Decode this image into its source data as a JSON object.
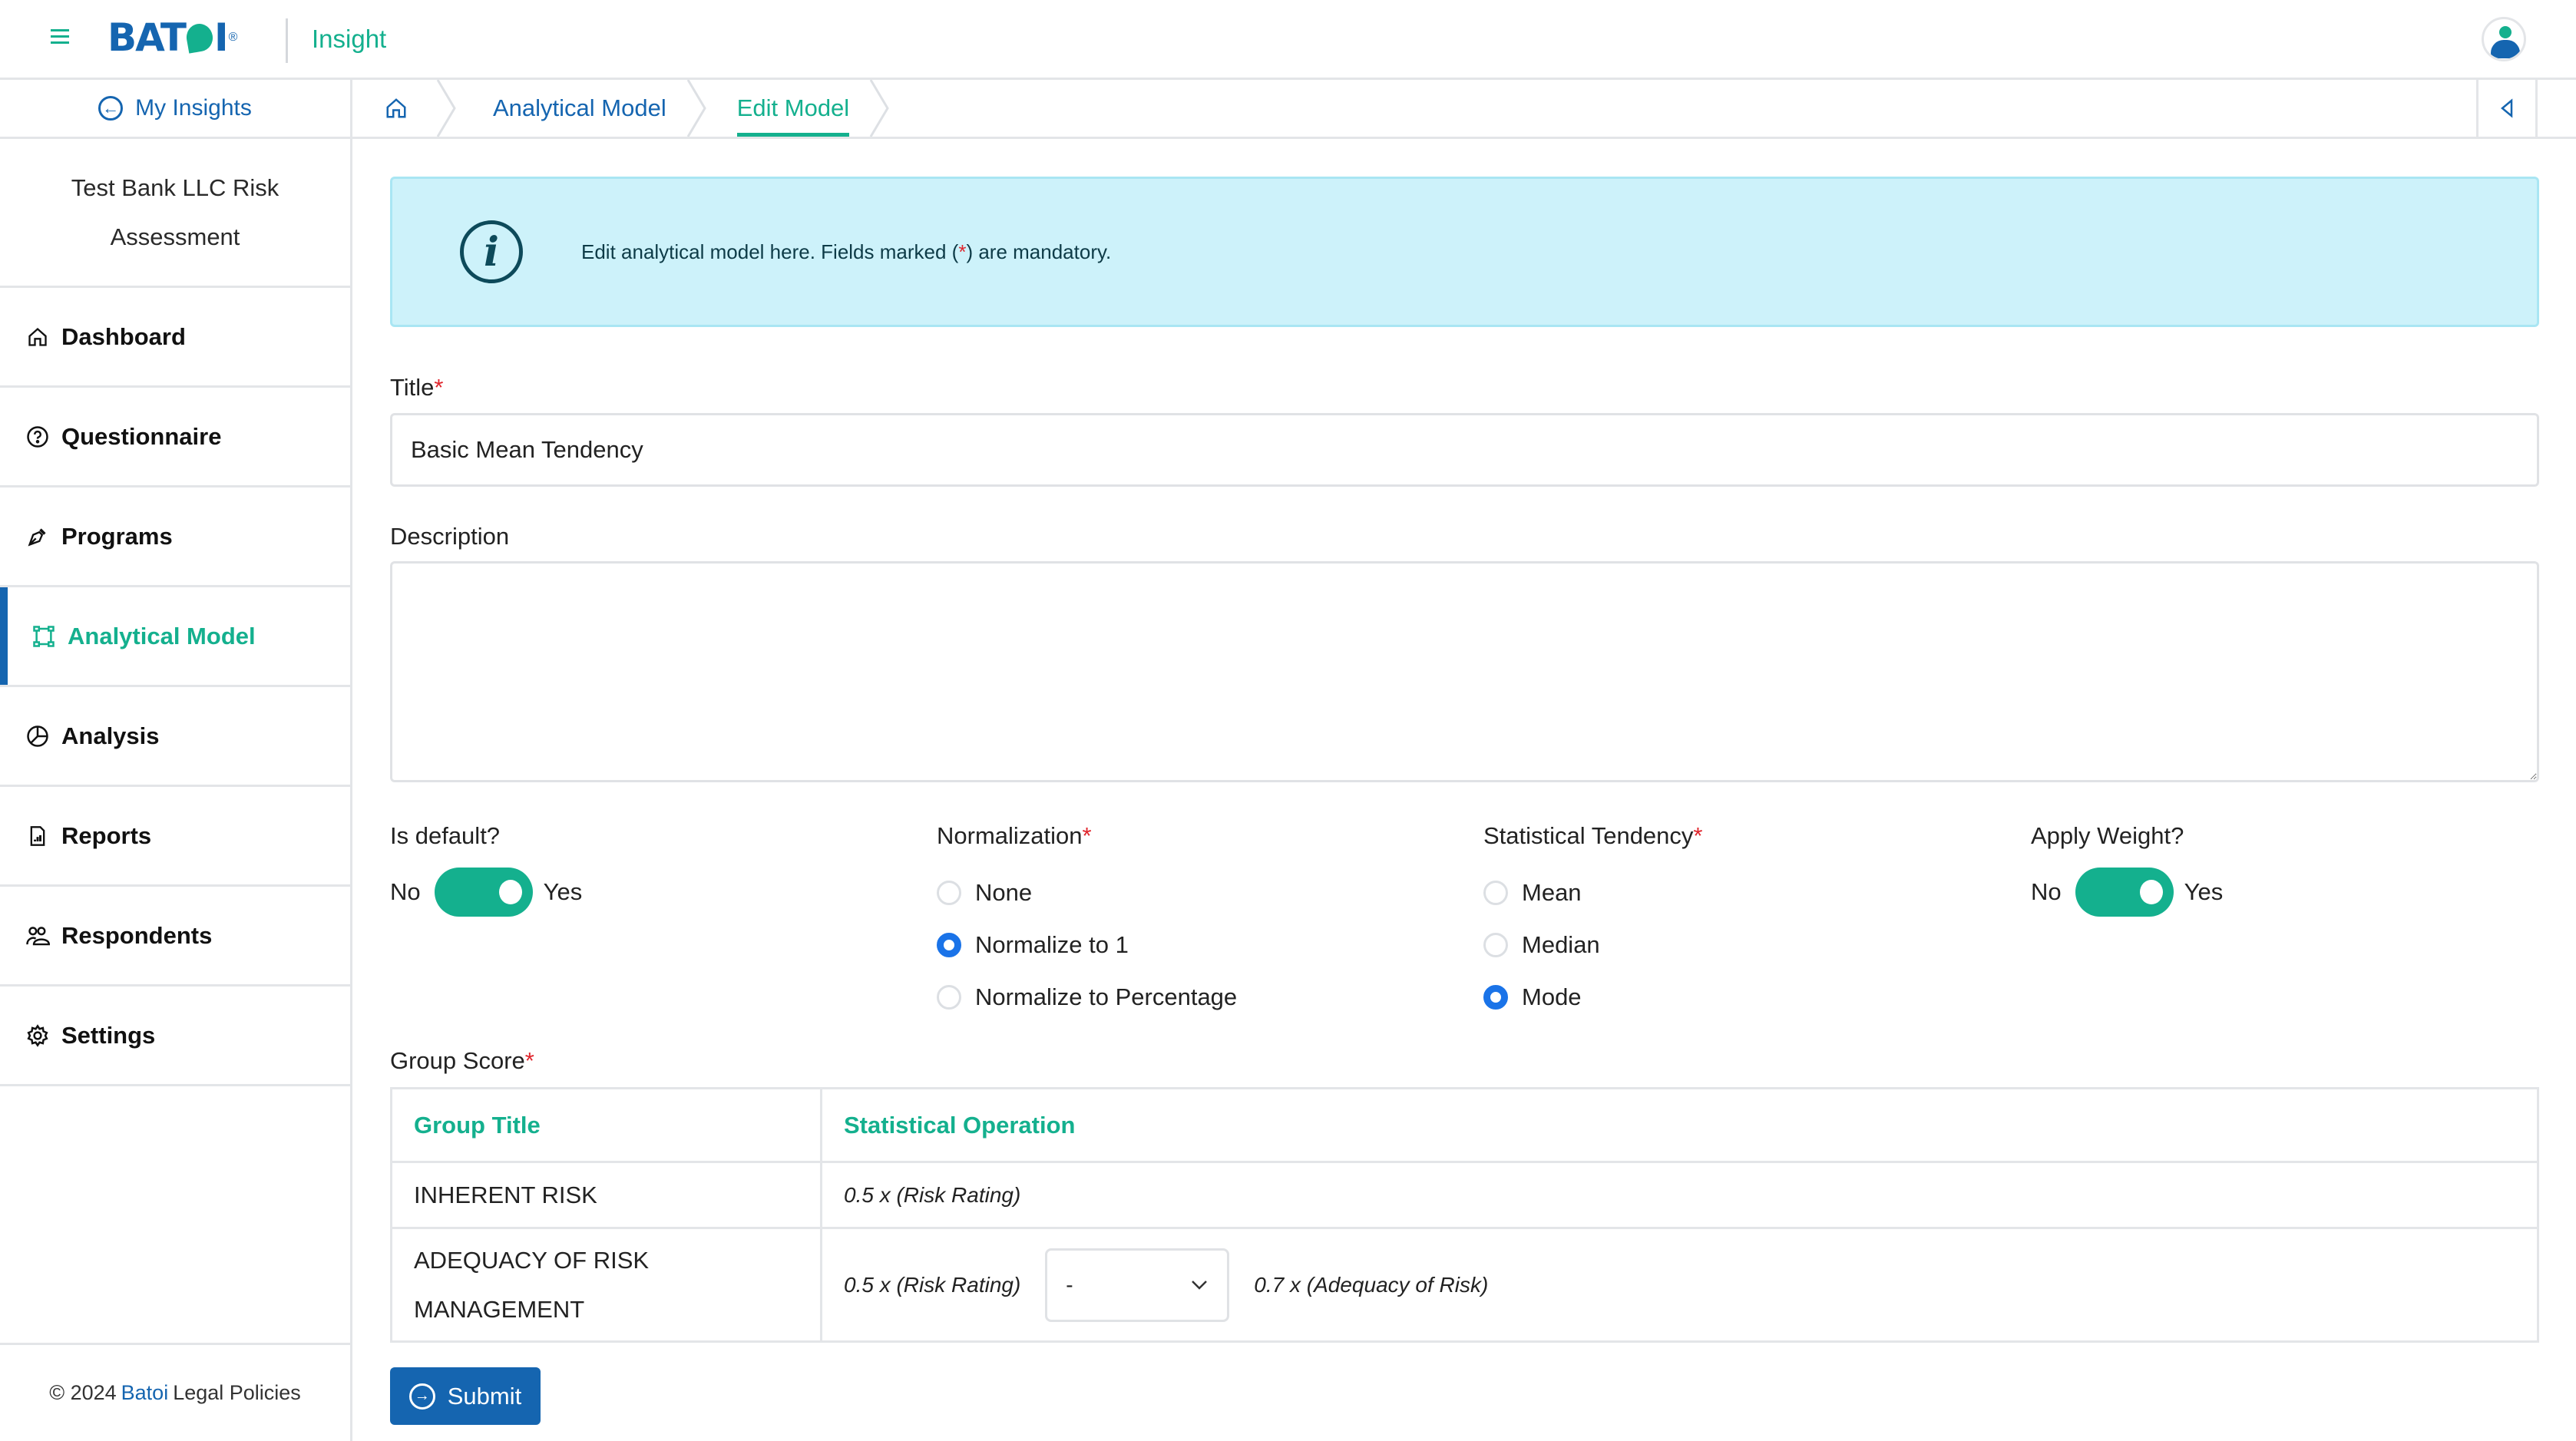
{
  "header": {
    "logo_text_left": "BAT",
    "logo_text_right": "I",
    "logo_reg": "®",
    "app_name": "Insight",
    "menu_icon": "hamburger-icon",
    "avatar_icon": "user-avatar-icon"
  },
  "breadcrumb": {
    "back_label": "My Insights",
    "home_icon": "home-icon",
    "items": [
      {
        "label": "Analytical Model"
      },
      {
        "label": "Edit Model",
        "active": true
      }
    ],
    "collapse_icon": "triangle-left-icon"
  },
  "sidebar": {
    "org_name": "Test Bank LLC Risk Assessment",
    "items": [
      {
        "label": "Dashboard",
        "icon": "home-icon"
      },
      {
        "label": "Questionnaire",
        "icon": "question-circle-icon"
      },
      {
        "label": "Programs",
        "icon": "pen-nib-icon"
      },
      {
        "label": "Analytical Model",
        "icon": "bounding-box-icon",
        "active": true
      },
      {
        "label": "Analysis",
        "icon": "pie-chart-icon"
      },
      {
        "label": "Reports",
        "icon": "report-chart-icon"
      },
      {
        "label": "Respondents",
        "icon": "people-icon"
      },
      {
        "label": "Settings",
        "icon": "gear-icon"
      }
    ],
    "footer": {
      "copyright": "© 2024",
      "brand": "Batoi",
      "legal": "Legal Policies"
    }
  },
  "info_banner": {
    "text_before": "Edit analytical model here. Fields marked (",
    "asterisk": "*",
    "text_after": ") are mandatory."
  },
  "form": {
    "title_label": "Title",
    "title_value": "Basic Mean Tendency",
    "description_label": "Description",
    "description_value": "",
    "required_mark": "*",
    "is_default": {
      "label": "Is default?",
      "off_label": "No",
      "on_label": "Yes",
      "value": true
    },
    "normalization": {
      "label": "Normalization",
      "options": [
        "None",
        "Normalize to 1",
        "Normalize to Percentage"
      ],
      "selected": "Normalize to 1"
    },
    "statistical_tendency": {
      "label": "Statistical Tendency",
      "options": [
        "Mean",
        "Median",
        "Mode"
      ],
      "selected": "Mode"
    },
    "apply_weight": {
      "label": "Apply Weight?",
      "off_label": "No",
      "on_label": "Yes",
      "value": true
    },
    "group_score": {
      "label": "Group Score",
      "columns": [
        "Group Title",
        "Statistical Operation"
      ],
      "rows": [
        {
          "title": "INHERENT RISK",
          "operation": "0.5 x (Risk Rating)"
        },
        {
          "title": "ADEQUACY OF RISK MANAGEMENT",
          "operation_left": "0.5 x (Risk Rating)",
          "operator_select": "-",
          "operation_right": "0.7 x (Adequacy of Risk)"
        }
      ]
    },
    "submit_label": "Submit"
  },
  "colors": {
    "brand_blue": "#1565b0",
    "brand_green": "#14b08e",
    "info_bg": "#cdf2fa",
    "required_red": "#e0262d",
    "radio_blue": "#1a73e8"
  }
}
